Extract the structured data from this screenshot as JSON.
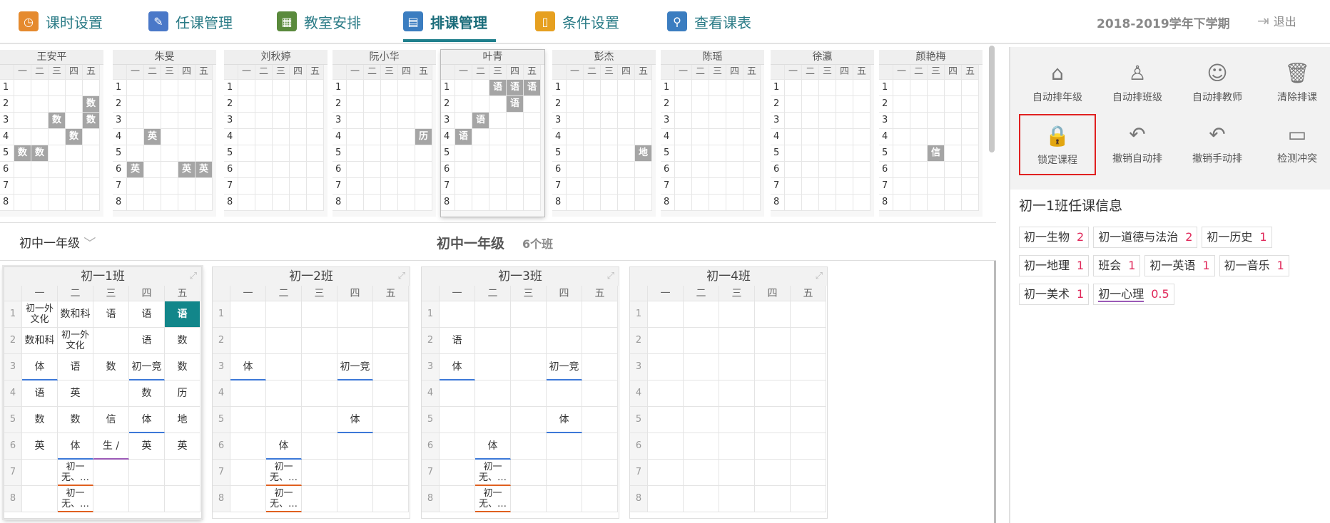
{
  "nav": {
    "items": [
      {
        "label": "课时设置",
        "icon": "clock-icon",
        "color": "#e58a2e"
      },
      {
        "label": "任课管理",
        "icon": "pencil-icon",
        "color": "#4a78c8"
      },
      {
        "label": "教室安排",
        "icon": "blackboard-icon",
        "color": "#5a8a3c"
      },
      {
        "label": "排课管理",
        "icon": "calendar-icon",
        "color": "#3b7dc0"
      },
      {
        "label": "条件设置",
        "icon": "document-icon",
        "color": "#e6a020"
      },
      {
        "label": "查看课表",
        "icon": "magnifier-icon",
        "color": "#3b7dc0"
      }
    ],
    "active_index": 3,
    "term": "2018-2019学年下学期",
    "logout": "退出"
  },
  "days": [
    "一",
    "二",
    "三",
    "四",
    "五"
  ],
  "teachers": [
    {
      "name": "王安平",
      "cells": {
        "2-5": "数",
        "3-3": "数",
        "3-5": "数",
        "4-4": "数",
        "5-1": "数",
        "5-2": "数"
      }
    },
    {
      "name": "朱旻",
      "cells": {
        "4-2": "英",
        "6-1": "英",
        "6-4": "英",
        "6-5": "英"
      }
    },
    {
      "name": "刘秋婷",
      "cells": {}
    },
    {
      "name": "阮小华",
      "cells": {
        "4-5": "历"
      }
    },
    {
      "name": "叶青",
      "cells": {
        "1-3": "语",
        "1-4": "语",
        "1-5": "语",
        "2-4": "语",
        "3-2": "语",
        "4-1": "语"
      }
    },
    {
      "name": "彭杰",
      "cells": {
        "5-5": "地"
      }
    },
    {
      "name": "陈瑶",
      "cells": {}
    },
    {
      "name": "徐瀛",
      "cells": {}
    },
    {
      "name": "颜艳梅",
      "cells": {
        "5-3": "信"
      }
    }
  ],
  "grade": {
    "select_label": "初中一年级",
    "title": "初中一年级",
    "count": "6个班"
  },
  "classes": [
    {
      "name": "初一1班",
      "rows": [
        [
          "初一外\n文化",
          "数和科",
          "语",
          "语",
          "语"
        ],
        [
          "数和科",
          "初一外\n文化",
          "",
          "语",
          "数"
        ],
        [
          "体",
          "语",
          "数",
          "初一竞",
          "数"
        ],
        [
          "语",
          "英",
          "",
          "数",
          "历"
        ],
        [
          "数",
          "数",
          "信",
          "体",
          "地"
        ],
        [
          "英",
          "体",
          "生 /",
          "英",
          "英"
        ],
        [
          "",
          "初一\n无、…",
          "",
          "",
          ""
        ],
        [
          "",
          "初一\n无、…",
          "",
          "",
          ""
        ]
      ]
    },
    {
      "name": "初一2班",
      "rows": [
        [
          "",
          "",
          "",
          "",
          ""
        ],
        [
          "",
          "",
          "",
          "",
          ""
        ],
        [
          "体",
          "",
          "",
          "初一竞",
          ""
        ],
        [
          "",
          "",
          "",
          "",
          ""
        ],
        [
          "",
          "",
          "",
          "体",
          ""
        ],
        [
          "",
          "体",
          "",
          "",
          ""
        ],
        [
          "",
          "初一\n无、…",
          "",
          "",
          ""
        ],
        [
          "",
          "初一\n无、…",
          "",
          "",
          ""
        ]
      ]
    },
    {
      "name": "初一3班",
      "rows": [
        [
          "",
          "",
          "",
          "",
          ""
        ],
        [
          "语",
          "",
          "",
          "",
          ""
        ],
        [
          "体",
          "",
          "",
          "初一竞",
          ""
        ],
        [
          "",
          "",
          "",
          "",
          ""
        ],
        [
          "",
          "",
          "",
          "体",
          ""
        ],
        [
          "",
          "体",
          "",
          "",
          ""
        ],
        [
          "",
          "初一\n无、…",
          "",
          "",
          ""
        ],
        [
          "",
          "初一\n无、…",
          "",
          "",
          ""
        ]
      ]
    },
    {
      "name": "初一4班",
      "rows": [
        [
          "",
          "",
          "",
          "",
          ""
        ],
        [
          "",
          "",
          "",
          "",
          ""
        ],
        [
          "",
          "",
          "",
          "",
          ""
        ],
        [
          "",
          "",
          "",
          "",
          ""
        ],
        [
          "",
          "",
          "",
          "",
          ""
        ],
        [
          "",
          "",
          "",
          "",
          ""
        ],
        [
          "",
          "",
          "",
          "",
          ""
        ],
        [
          "",
          "",
          "",
          "",
          ""
        ]
      ]
    }
  ],
  "tools": [
    {
      "label": "自动排年级",
      "icon": "grade-icon"
    },
    {
      "label": "自动排班级",
      "icon": "class-icon"
    },
    {
      "label": "自动排教师",
      "icon": "teacher-icon"
    },
    {
      "label": "清除排课",
      "icon": "trash-icon"
    },
    {
      "label": "锁定课程",
      "icon": "lock-icon"
    },
    {
      "label": "撤销自动排",
      "icon": "undo-a-icon"
    },
    {
      "label": "撤销手动排",
      "icon": "undo-m-icon"
    },
    {
      "label": "检测冲突",
      "icon": "monitor-icon"
    }
  ],
  "info": {
    "title": "初一1班任课信息",
    "chips": [
      {
        "label": "初一生物",
        "count": "2"
      },
      {
        "label": "初一道德与法治",
        "count": "2"
      },
      {
        "label": "初一历史",
        "count": "1"
      },
      {
        "label": "初一地理",
        "count": "1"
      },
      {
        "label": "班会",
        "count": "1"
      },
      {
        "label": "初一英语",
        "count": "1"
      },
      {
        "label": "初一音乐",
        "count": "1"
      },
      {
        "label": "初一美术",
        "count": "1"
      },
      {
        "label": "初一心理",
        "count": "0.5"
      }
    ]
  }
}
